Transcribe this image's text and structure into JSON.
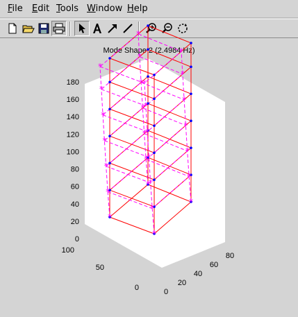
{
  "menubar": {
    "items": [
      {
        "label": "File",
        "key": "F",
        "rest": "ile"
      },
      {
        "label": "Edit",
        "key": "E",
        "rest": "dit"
      },
      {
        "label": "Tools",
        "key": "T",
        "rest": "ools"
      },
      {
        "label": "Window",
        "key": "W",
        "rest": "indow"
      },
      {
        "label": "Help",
        "key": "H",
        "rest": "elp"
      }
    ]
  },
  "toolbar": {
    "buttons": [
      {
        "name": "new-file-icon"
      },
      {
        "name": "open-folder-icon"
      },
      {
        "name": "save-icon"
      },
      {
        "name": "print-icon"
      },
      {
        "name": "arrow-pointer-icon",
        "pressed": true
      },
      {
        "name": "insert-text-icon"
      },
      {
        "name": "insert-arrow-icon"
      },
      {
        "name": "insert-line-icon"
      },
      {
        "name": "zoom-in-icon"
      },
      {
        "name": "zoom-out-icon"
      },
      {
        "name": "rotate-3d-icon"
      }
    ]
  },
  "chart_data": {
    "type": "line",
    "title": "Mode Shape 2 (2.4984 Hz)",
    "z_ticks": [
      "0",
      "20",
      "40",
      "60",
      "80",
      "100",
      "120",
      "140",
      "160",
      "180"
    ],
    "y_ticks": [
      "0",
      "50",
      "100"
    ],
    "x_ticks": [
      "0",
      "20",
      "40",
      "60",
      "80"
    ],
    "zlim": [
      0,
      180
    ],
    "ylim": [
      0,
      100
    ],
    "xlim": [
      0,
      80
    ],
    "series": [
      {
        "style": "red solid lines with blue point markers",
        "color": "#ff0000"
      },
      {
        "style": "magenta dashed lines with star markers",
        "color": "#ff00ff"
      }
    ],
    "grid": false
  },
  "colors": {
    "background": "#d4d4d4",
    "axes_face": "#ffffff",
    "undeformed": "#ff0000",
    "node": "#0000ff",
    "mode_shape": "#ff00ff"
  }
}
